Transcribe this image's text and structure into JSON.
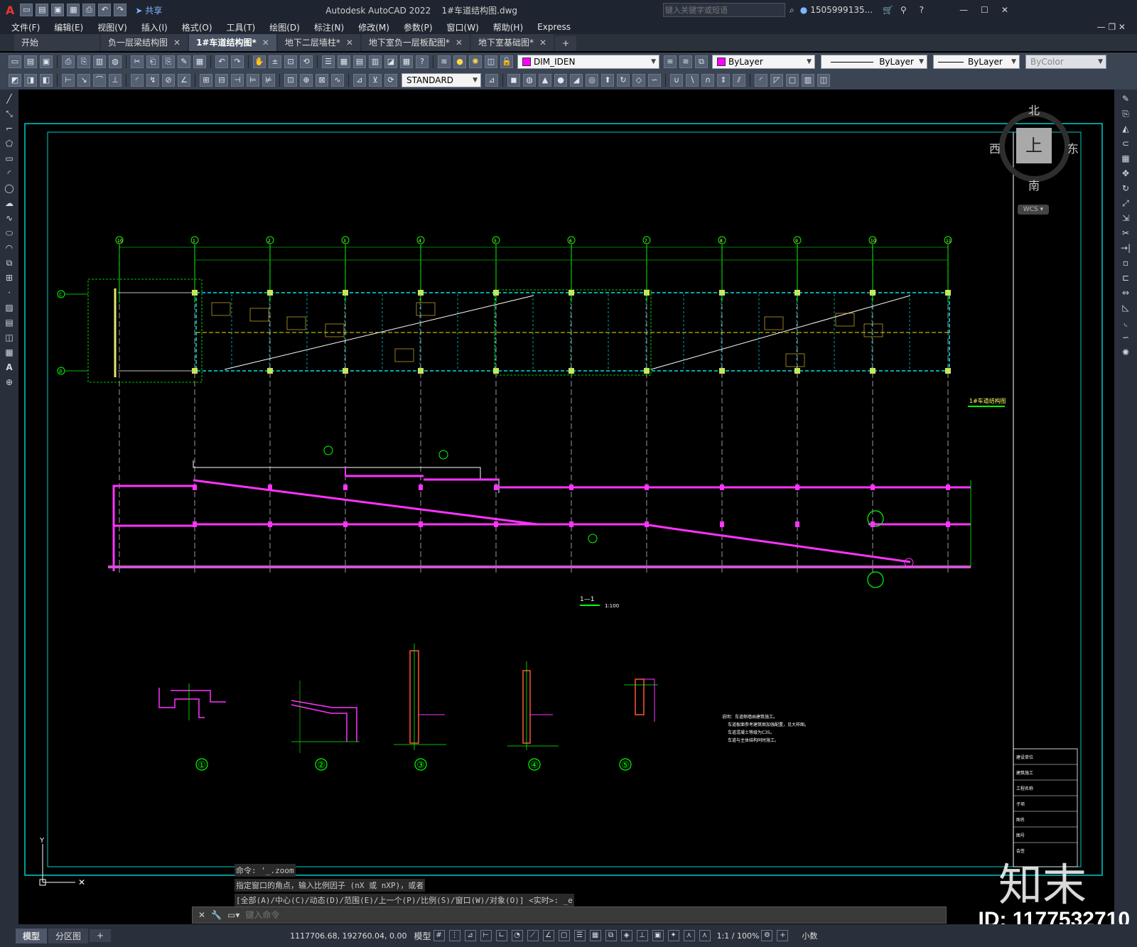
{
  "titlebar": {
    "app_letter": "A",
    "share_label": "共享",
    "app_name": "Autodesk AutoCAD 2022",
    "filename": "1#车道结构图.dwg",
    "search_placeholder": "键入关键字或短语",
    "user": "1505999135...",
    "window_controls": [
      "—",
      "☐",
      "✕"
    ]
  },
  "menu": [
    "文件(F)",
    "编辑(E)",
    "视图(V)",
    "插入(I)",
    "格式(O)",
    "工具(T)",
    "绘图(D)",
    "标注(N)",
    "修改(M)",
    "参数(P)",
    "窗口(W)",
    "帮助(H)",
    "Express"
  ],
  "tabs": [
    {
      "label": "开始",
      "active": false,
      "closable": false
    },
    {
      "label": "负一层梁结构图",
      "active": false,
      "closable": true
    },
    {
      "label": "1#车道结构图*",
      "active": true,
      "closable": true
    },
    {
      "label": "地下二层墙柱*",
      "active": false,
      "closable": true
    },
    {
      "label": "地下室负一层板配图*",
      "active": false,
      "closable": true
    },
    {
      "label": "地下室基础图*",
      "active": false,
      "closable": true
    }
  ],
  "layer_dropdown": "DIM_IDEN",
  "color_dropdown": "ByLayer",
  "linetype_dropdown": "ByLayer",
  "lineweight_dropdown": "ByLayer",
  "plotstyle_dropdown": "ByColor",
  "textstyle_dropdown": "STANDARD",
  "viewcube": {
    "north": "北",
    "south": "南",
    "west": "西",
    "east": "东",
    "top": "上",
    "wcs": "WCS"
  },
  "drawing": {
    "plan_title": "1#车道结构图",
    "section_label": "1—1",
    "section_scale": "1:100",
    "detail_labels": [
      "①",
      "②",
      "③",
      "④",
      "⑤"
    ],
    "grid_labels": [
      "10",
      "1",
      "2",
      "3",
      "4",
      "5",
      "6",
      "7",
      "8",
      "9",
      "10",
      "11"
    ],
    "row_labels": [
      "C",
      "B"
    ],
    "notes": [
      "说明：车道侧墙由建筑施工。",
      "车道板面参考建筑图加强配置，见大样图。",
      "车道混凝土等级为C35。",
      "车道与主体结构同时施工。"
    ],
    "titleblock": [
      "建设单位",
      "建筑施工",
      "工程名称",
      "子项",
      "图名",
      "图号",
      "会签"
    ],
    "stroke_colors": {
      "axis": "#00ff00",
      "beam": "#00e5e5",
      "wall": "#ff33ff",
      "text": "#ffff00",
      "white": "#ffffff",
      "frame": "#00cccc"
    }
  },
  "command": {
    "history": [
      "命令: '_.zoom",
      "指定窗口的角点，输入比例因子 (nX 或 nXP)，或者",
      "[全部(A)/中心(C)/动态(D)/范围(E)/上一个(P)/比例(S)/窗口(W)/对象(O)] <实时>: _e"
    ],
    "placeholder": "键入命令"
  },
  "status": {
    "layout_tabs": [
      "模型",
      "分区图"
    ],
    "coords": "1117706.68, 192760.04, 0.00",
    "mode": "模型",
    "scale": "1:1 / 100%",
    "units": "小数"
  },
  "watermark": {
    "logo": "知末",
    "id": "ID: 1177532710"
  }
}
